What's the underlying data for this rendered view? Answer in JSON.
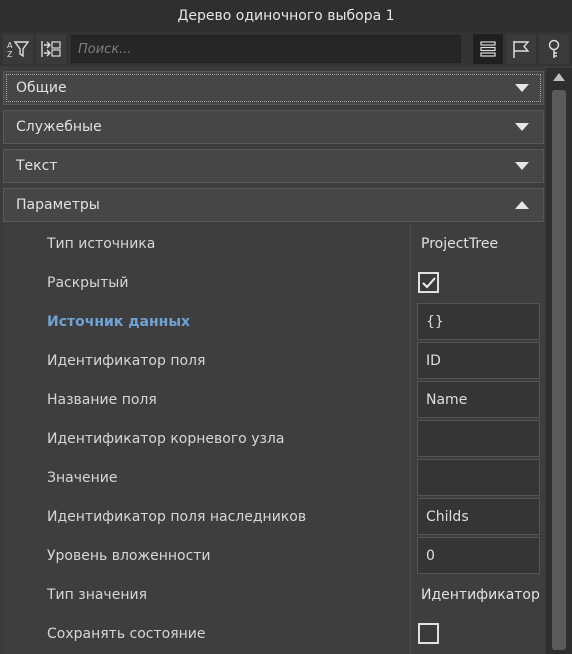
{
  "window": {
    "title": "Дерево одиночного выбора 1"
  },
  "toolbar": {
    "search_placeholder": "Поиск...",
    "icons": [
      "sort-filter-icon",
      "collapse-expand-icon",
      "list-view-icon",
      "flag-icon",
      "key-icon"
    ]
  },
  "sections": [
    {
      "label": "Общие",
      "expanded": false
    },
    {
      "label": "Служебные",
      "expanded": false
    },
    {
      "label": "Текст",
      "expanded": false
    },
    {
      "label": "Параметры",
      "expanded": true
    }
  ],
  "params": [
    {
      "label": "Тип источника",
      "type": "text",
      "value": "ProjectTree"
    },
    {
      "label": "Раскрытый",
      "type": "checkbox",
      "checked": true
    },
    {
      "label": "Источник данных",
      "type": "field",
      "value": "{}",
      "highlight": true
    },
    {
      "label": "Идентификатор поля",
      "type": "field",
      "value": "ID"
    },
    {
      "label": "Название поля",
      "type": "field",
      "value": "Name"
    },
    {
      "label": "Идентификатор корневого узла",
      "type": "field",
      "value": ""
    },
    {
      "label": "Значение",
      "type": "field",
      "value": ""
    },
    {
      "label": "Идентификатор поля наследников",
      "type": "field",
      "value": "Childs"
    },
    {
      "label": "Уровень вложенности",
      "type": "field",
      "value": "0"
    },
    {
      "label": "Тип значения",
      "type": "text",
      "value": "Идентификатор"
    },
    {
      "label": "Сохранять состояние",
      "type": "checkbox",
      "checked": false
    }
  ],
  "colors": {
    "background": "#3c3c3c",
    "section_bg": "#464646",
    "highlight_label": "#6fa3d6"
  }
}
